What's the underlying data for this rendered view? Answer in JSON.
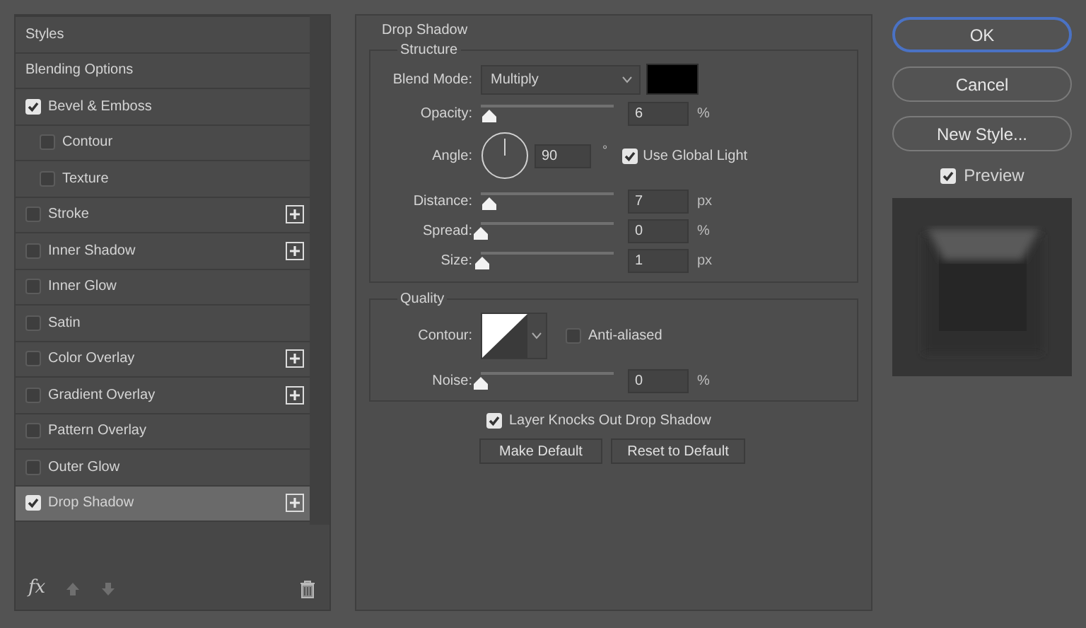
{
  "styles_panel": {
    "header": "Styles",
    "items": [
      {
        "kind": "plain",
        "label": "Blending Options",
        "selected": false
      },
      {
        "kind": "check",
        "label": "Bevel & Emboss",
        "checked": true,
        "selected": false,
        "add": false,
        "children": [
          {
            "kind": "check",
            "label": "Contour",
            "checked": false,
            "selected": false,
            "add": false
          },
          {
            "kind": "check",
            "label": "Texture",
            "checked": false,
            "selected": false,
            "add": false
          }
        ]
      },
      {
        "kind": "check",
        "label": "Stroke",
        "checked": false,
        "selected": false,
        "add": true
      },
      {
        "kind": "check",
        "label": "Inner Shadow",
        "checked": false,
        "selected": false,
        "add": true
      },
      {
        "kind": "check",
        "label": "Inner Glow",
        "checked": false,
        "selected": false,
        "add": false
      },
      {
        "kind": "check",
        "label": "Satin",
        "checked": false,
        "selected": false,
        "add": false
      },
      {
        "kind": "check",
        "label": "Color Overlay",
        "checked": false,
        "selected": false,
        "add": true
      },
      {
        "kind": "check",
        "label": "Gradient Overlay",
        "checked": false,
        "selected": false,
        "add": true
      },
      {
        "kind": "check",
        "label": "Pattern Overlay",
        "checked": false,
        "selected": false,
        "add": false
      },
      {
        "kind": "check",
        "label": "Outer Glow",
        "checked": false,
        "selected": false,
        "add": false
      },
      {
        "kind": "check",
        "label": "Drop Shadow",
        "checked": true,
        "selected": true,
        "add": true
      }
    ],
    "fx": "fx"
  },
  "drop_shadow": {
    "title": "Drop Shadow",
    "structure": {
      "title": "Structure",
      "blend_mode": {
        "label": "Blend Mode:",
        "value": "Multiply"
      },
      "opacity": {
        "label": "Opacity:",
        "value": "6",
        "unit": "%",
        "level": 0.06
      },
      "angle": {
        "label": "Angle:",
        "value": "90",
        "unit": "°",
        "global_light": {
          "label": "Use Global Light",
          "checked": true
        }
      },
      "sliders": [
        {
          "label": "Distance:",
          "value": "7",
          "unit": "px",
          "level": 0.06
        },
        {
          "label": "Spread:",
          "value": "0",
          "unit": "%",
          "level": 0
        },
        {
          "label": "Size:",
          "value": "1",
          "unit": "px",
          "level": 0.01
        }
      ]
    },
    "quality": {
      "title": "Quality",
      "contour": {
        "label": "Contour:"
      },
      "anti_aliased": {
        "label": "Anti-aliased",
        "checked": false
      },
      "noise": {
        "label": "Noise:",
        "value": "0",
        "unit": "%",
        "level": 0
      }
    },
    "layer_knocks_out": {
      "label": "Layer Knocks Out Drop Shadow",
      "checked": true
    },
    "buttons": [
      "Make Default",
      "Reset to Default"
    ]
  },
  "dialog_buttons": [
    {
      "label": "OK",
      "default": true
    },
    {
      "label": "Cancel",
      "default": false
    },
    {
      "label": "New Style...",
      "default": false
    }
  ],
  "preview": {
    "label": "Preview",
    "checked": true
  }
}
